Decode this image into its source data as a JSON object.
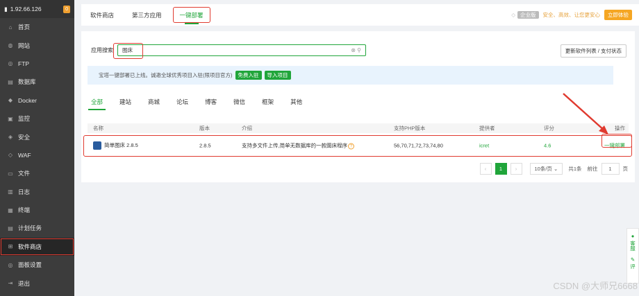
{
  "sidebar": {
    "ip": "1.92.66.126",
    "badge": "0",
    "items": [
      {
        "label": "首页",
        "icon": "⌂"
      },
      {
        "label": "网站",
        "icon": "◍"
      },
      {
        "label": "FTP",
        "icon": "◎"
      },
      {
        "label": "数据库",
        "icon": "▤"
      },
      {
        "label": "Docker",
        "icon": "◆"
      },
      {
        "label": "监控",
        "icon": "▣"
      },
      {
        "label": "安全",
        "icon": "◈"
      },
      {
        "label": "WAF",
        "icon": "◇"
      },
      {
        "label": "文件",
        "icon": "▭"
      },
      {
        "label": "日志",
        "icon": "▥"
      },
      {
        "label": "终端",
        "icon": "▦"
      },
      {
        "label": "计划任务",
        "icon": "▤"
      },
      {
        "label": "软件商店",
        "icon": "⊞",
        "active": true
      },
      {
        "label": "面板设置",
        "icon": "◎"
      },
      {
        "label": "退出",
        "icon": "⇥"
      }
    ]
  },
  "tabs": [
    "软件商店",
    "第三方应用",
    "一键部署"
  ],
  "promo": {
    "pro": "企业版",
    "text": "安全、高效、让您更安心",
    "button": "立即体验"
  },
  "search": {
    "label": "应用搜索",
    "value": "图床"
  },
  "update_button": "更新软件列表 / 支付状态",
  "notice": {
    "text": "宝塔一键部署已上线。诚邀全球优秀项目入驻(限项目官方)",
    "btn1": "免费入驻",
    "btn2": "导入项目"
  },
  "categories": [
    "全部",
    "建站",
    "商城",
    "论坛",
    "博客",
    "微信",
    "框架",
    "其他"
  ],
  "table": {
    "headers": {
      "name": "名称",
      "version": "版本",
      "desc": "介绍",
      "php": "支持PHP版本",
      "provider": "提供者",
      "score": "评分",
      "op": "操作"
    },
    "row": {
      "name": "简单图床 2.8.5",
      "version": "2.8.5",
      "desc": "支持多文件上传,简单无数据库的一款图床程序",
      "php": "56,70,71,72,73,74,80",
      "provider": "icret",
      "score": "4.6",
      "op": "一键部署"
    }
  },
  "pager": {
    "current": "1",
    "page_size": "10条/页",
    "total": "共1条",
    "goto_label": "前往",
    "goto_value": "1",
    "page_unit": "页"
  },
  "float_panel": {
    "item1": "客服",
    "item2": "评"
  },
  "watermark": "CSDN @大师兄6668",
  "colors": {
    "accent": "#20a53a",
    "highlight": "#e03a2f",
    "sidebar": "#3c3c3c"
  }
}
